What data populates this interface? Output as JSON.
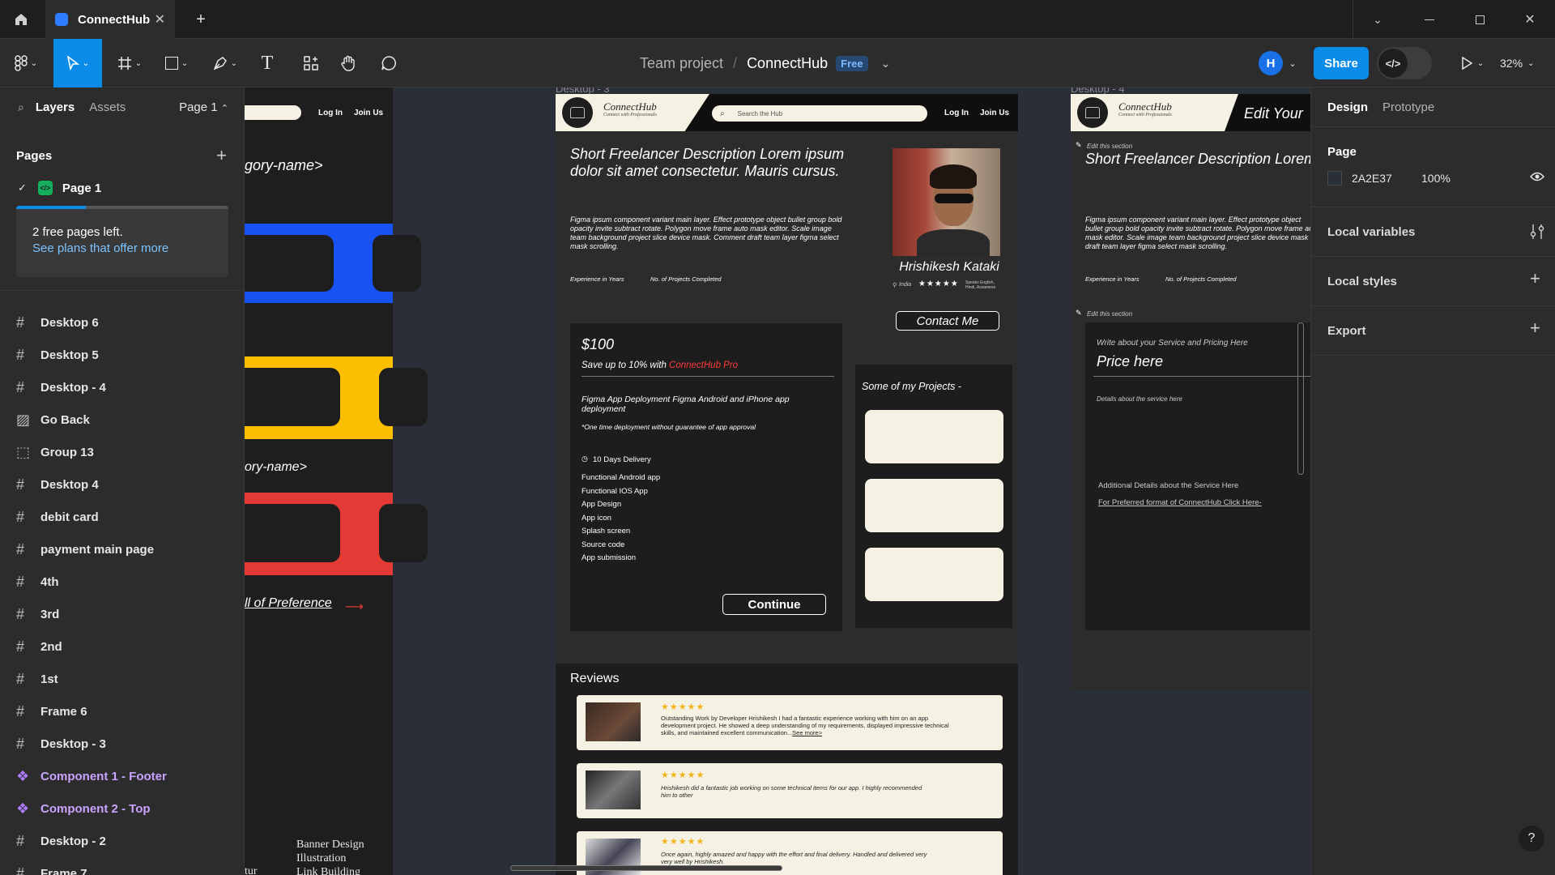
{
  "app": {
    "tab_title": "ConnectHub",
    "breadcrumb_team": "Team project",
    "breadcrumb_sep": "/",
    "file_name": "ConnectHub",
    "plan_badge": "Free",
    "share_label": "Share",
    "zoom": "32%",
    "avatar_letter": "H"
  },
  "left_panel": {
    "tab_layers": "Layers",
    "tab_assets": "Assets",
    "page_select": "Page 1",
    "pages_heading": "Pages",
    "current_page": "Page 1",
    "free_pages_text": "2 free pages left.",
    "free_pages_link": "See plans that offer more",
    "free_pages_progress": 0.33,
    "layers": [
      {
        "name": "Desktop 6",
        "type": "frame"
      },
      {
        "name": "Desktop 5",
        "type": "frame"
      },
      {
        "name": "Desktop - 4",
        "type": "frame"
      },
      {
        "name": "Go Back",
        "type": "image"
      },
      {
        "name": "Group 13",
        "type": "group"
      },
      {
        "name": "Desktop 4",
        "type": "frame"
      },
      {
        "name": "debit card",
        "type": "frame"
      },
      {
        "name": "payment main page",
        "type": "frame"
      },
      {
        "name": "4th",
        "type": "frame"
      },
      {
        "name": "3rd",
        "type": "frame"
      },
      {
        "name": "2nd",
        "type": "frame"
      },
      {
        "name": "1st",
        "type": "frame"
      },
      {
        "name": "Frame 6",
        "type": "frame"
      },
      {
        "name": "Desktop - 3",
        "type": "frame"
      },
      {
        "name": "Component 1 - Footer",
        "type": "component"
      },
      {
        "name": "Component 2 - Top",
        "type": "component"
      },
      {
        "name": "Desktop - 2",
        "type": "frame"
      },
      {
        "name": "Frame 7",
        "type": "frame"
      }
    ]
  },
  "right_panel": {
    "tab_design": "Design",
    "tab_prototype": "Prototype",
    "page_heading": "Page",
    "page_color_hex": "2A2E37",
    "page_opacity": "100%",
    "local_variables": "Local variables",
    "local_styles": "Local styles",
    "export": "Export",
    "help": "?"
  },
  "canvas": {
    "left_frame": {
      "login": "Log In",
      "join": "Join Us",
      "category1": "gory-name>",
      "category2": "ory-name>",
      "preference": "ll of Preference",
      "footer_items": [
        "Banner Design",
        "Illustration",
        "Link Building"
      ],
      "footer_partial": "tur",
      "stripe_colors": [
        "#1752f5",
        "#fbbf00",
        "#e53935"
      ]
    },
    "frame_labels": {
      "center": "Desktop - 3",
      "right": "Desktop - 4"
    },
    "center_frame": {
      "brand": "ConnectHub",
      "brand_tagline": "Connect with Professionals",
      "search_placeholder": "Search the Hub",
      "login": "Log In",
      "join": "Join Us",
      "headline": "Short Freelancer Description Lorem ipsum dolor sit amet consectetur. Mauris cursus.",
      "body": "Figma ipsum component variant main layer. Effect prototype object bullet group bold opacity invite subtract rotate. Polygon move frame auto mask editor. Scale image team background project slice device mask. Comment draft team layer figma select mask scrolling.",
      "exp_label": "Experience in Years",
      "projects_label": "No. of Projects Completed",
      "name": "Hrishikesh Kataki",
      "location": "India",
      "languages": "Speaks English, Hindi, Assamese",
      "rating": 5,
      "contact_btn": "Contact Me",
      "price": "$100",
      "save_text": "Save up to 10% with ",
      "save_link": "ConnectHub Pro",
      "service_title": "Figma App Deployment Figma Android and iPhone app deployment",
      "service_note": "*One time deployment without guarantee of app approval",
      "delivery": "10 Days Delivery",
      "features": [
        "Functional Android app",
        "Functional IOS App",
        "App Design",
        "App icon",
        "Splash screen",
        "Source code",
        "App submission"
      ],
      "continue_btn": "Continue",
      "projects_heading": "Some of my Projects -",
      "reviews_heading": "Reviews",
      "reviews": [
        {
          "text": "Outstanding Work by Developer Hrishikesh I had a fantastic experience working with him on an app development project. He showed a deep understanding of my requirements, displayed impressive technical skills, and maintained excellent communication...",
          "more": "See more>",
          "rating": 5
        },
        {
          "text": "Hrishikesh did a fantastic job working on some technical items for our app. I highly recommended him to other",
          "more": "",
          "rating": 5
        },
        {
          "text": "Once again, highly amazed and happy with the effort and final delivery. Handled and delivered very very well by Hrishikesh.",
          "more": "",
          "rating": 5
        }
      ]
    },
    "right_frame": {
      "brand": "ConnectHub",
      "brand_tagline": "Connect with Professionals",
      "title": "Edit Your",
      "edit_section_1": "Edit this section",
      "headline": "Short Freelancer Description Lorem ipsum dolor sit amet consectetur. Mauris",
      "body": "Figma ipsum component variant main layer. Effect prototype object bullet group bold opacity invite subtract rotate. Polygon move frame auto mask editor. Scale image team background project slice device mask draft team layer figma select mask scrolling.",
      "exp_label": "Experience in Years",
      "projects_label": "No. of Projects Completed",
      "edit_section_2": "Edit this section",
      "write_about": "Write about your Service and Pricing Here",
      "price_here": "Price here",
      "details": "Details about the service here",
      "additional": "Additional Details about the Service Here",
      "preferred_link": "For Preferred format of ConnectHub Click Here-"
    }
  }
}
